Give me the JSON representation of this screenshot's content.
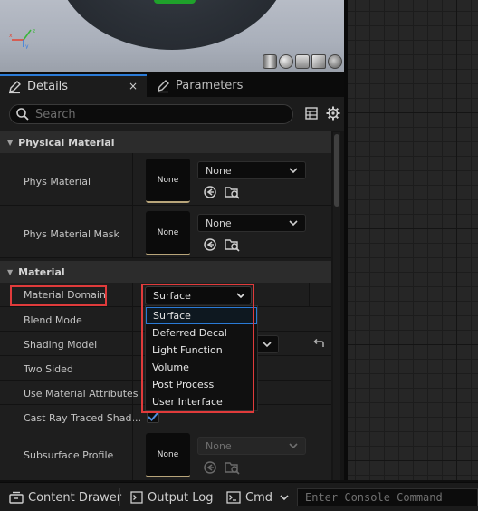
{
  "tabs": [
    {
      "label": "Details",
      "icon": "pencil-icon"
    },
    {
      "label": "Parameters",
      "icon": "pencil-icon"
    }
  ],
  "tab_close": "×",
  "search": {
    "placeholder": "Search"
  },
  "categories": {
    "physical": "Physical Material",
    "material": "Material"
  },
  "properties": {
    "phys_material": {
      "label": "Phys Material",
      "thumb": "None",
      "value": "None"
    },
    "phys_material_mask": {
      "label": "Phys Material Mask",
      "thumb": "None",
      "value": "None"
    },
    "material_domain": {
      "label": "Material Domain",
      "value": "Surface"
    },
    "blend_mode": {
      "label": "Blend Mode"
    },
    "shading_model": {
      "label": "Shading Model"
    },
    "two_sided": {
      "label": "Two Sided"
    },
    "use_material_attributes": {
      "label": "Use Material Attributes"
    },
    "cast_ray_traced_shadows": {
      "label": "Cast Ray Traced Shad..."
    },
    "subsurface_profile": {
      "label": "Subsurface Profile",
      "thumb": "None",
      "value": "None"
    }
  },
  "domain_options": [
    "Surface",
    "Deferred Decal",
    "Light Function",
    "Volume",
    "Post Process",
    "User Interface"
  ],
  "domain_selected": "Surface",
  "bottom_bar": {
    "content_drawer": "Content Drawer",
    "output_log": "Output Log",
    "cmd": "Cmd",
    "console_placeholder": "Enter Console Command"
  },
  "colors": {
    "accent": "#2a7ad6",
    "highlight": "#e03b3b",
    "checkbox": "#4d8fe0"
  }
}
